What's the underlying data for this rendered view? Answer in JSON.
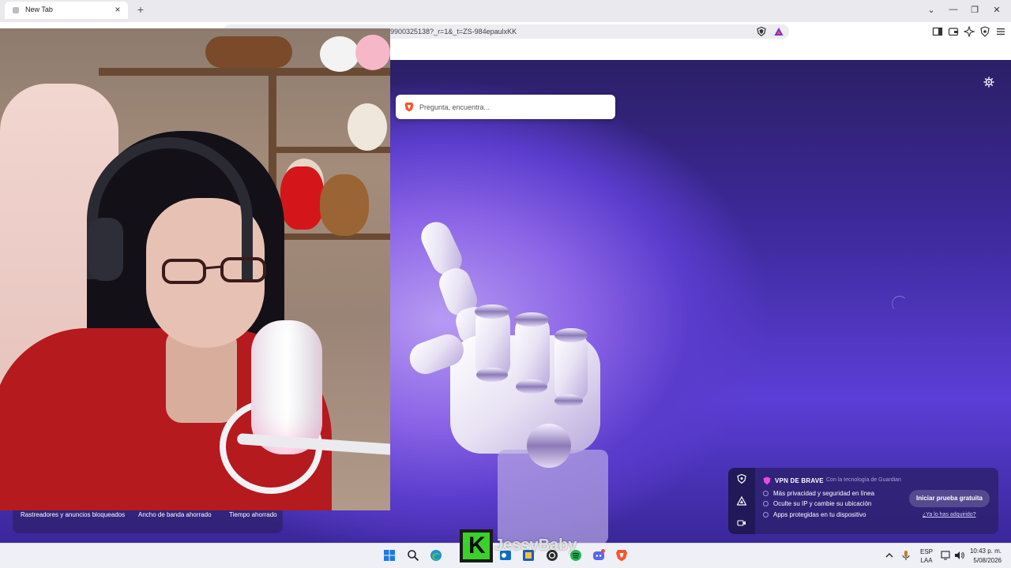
{
  "browser": {
    "tab_title": "New Tab",
    "tab_close": "×",
    "new_tab": "+",
    "url": "9900325138?_r=1&_t=ZS-984epaulxKK",
    "window_controls": {
      "dropdown": "⌄",
      "minimize": "—",
      "restore": "❐",
      "close": "✕"
    }
  },
  "newtab": {
    "search_placeholder": "Pregunta, encuentra...",
    "stats": {
      "trackers_label": "Rastreadores y anuncios bloqueados",
      "bandwidth_label": "Ancho de banda ahorrado",
      "time_label": "Tiempo ahorrado"
    },
    "vpn": {
      "title": "VPN DE BRAVE",
      "powered_by": "Con la tecnología de  Guardian",
      "features": [
        "Más privacidad y seguridad en línea",
        "Oculte su IP y cambie su ubicación",
        "Apps protegidas en tu dispositivo"
      ],
      "cta": "Iniciar prueba gratuita",
      "link": "¿Ya lo has adquirido?"
    }
  },
  "overlay": {
    "name": "JessyBaby",
    "logo_letter": "K"
  },
  "taskbar": {
    "lang_top": "ESP",
    "lang_bottom": "LAA",
    "time": "10:43 p. m.",
    "date": "5/08/2026"
  },
  "colors": {
    "accent_purple": "#5b3ed6",
    "brave_orange": "#fb542b",
    "kick_green": "#39d12a"
  }
}
